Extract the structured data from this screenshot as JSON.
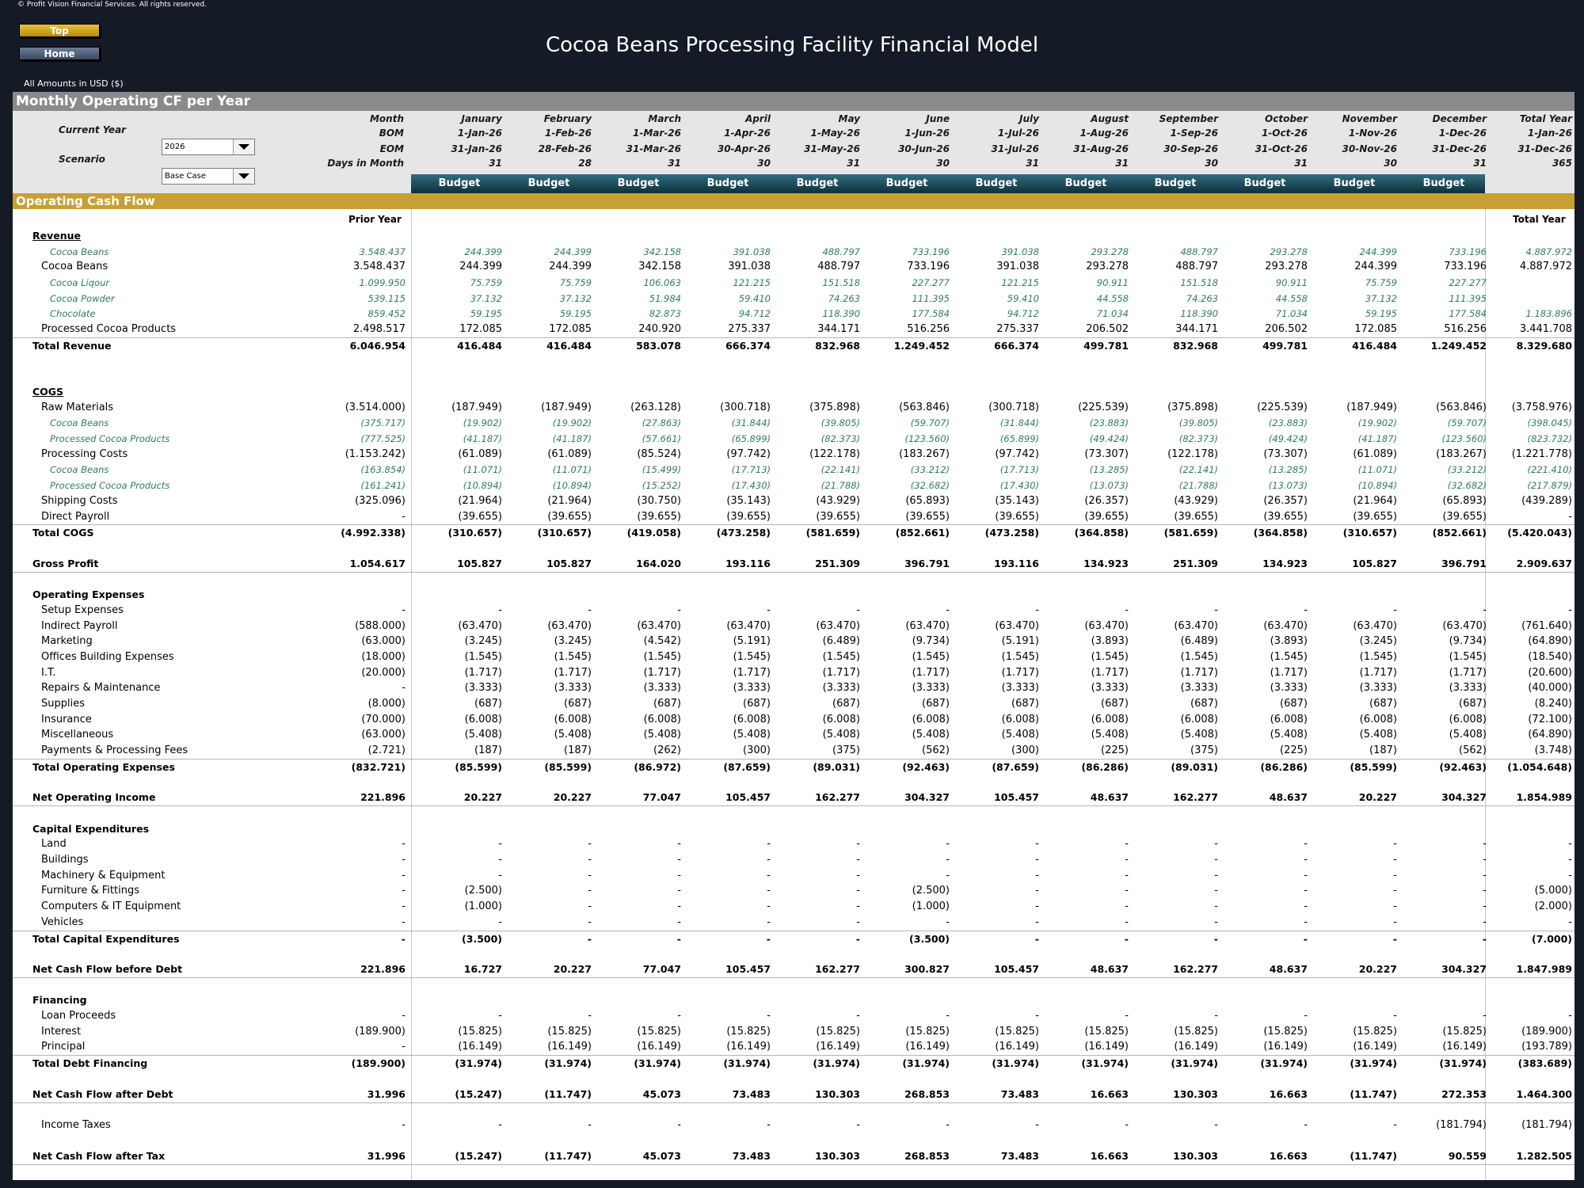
{
  "copyright": "© Profit Vision Financial Services. All rights reserved.",
  "nav": {
    "top": "Top",
    "home": "Home"
  },
  "title": "Cocoa Beans Processing Facility Financial Model",
  "amounts_label": "All Amounts in  USD ($)",
  "section_title": "Monthly Operating CF per Year",
  "current_year": {
    "label": "Current Year",
    "value": "2026"
  },
  "scenario": {
    "label": "Scenario",
    "value": "Base Case"
  },
  "header_labels": [
    "Month",
    "BOM",
    "EOM",
    "Days in Month"
  ],
  "months": [
    {
      "name": "January",
      "bom": "1-Jan-26",
      "eom": "31-Jan-26",
      "days": "31",
      "budget": "Budget"
    },
    {
      "name": "February",
      "bom": "1-Feb-26",
      "eom": "28-Feb-26",
      "days": "28",
      "budget": "Budget"
    },
    {
      "name": "March",
      "bom": "1-Mar-26",
      "eom": "31-Mar-26",
      "days": "31",
      "budget": "Budget"
    },
    {
      "name": "April",
      "bom": "1-Apr-26",
      "eom": "30-Apr-26",
      "days": "30",
      "budget": "Budget"
    },
    {
      "name": "May",
      "bom": "1-May-26",
      "eom": "31-May-26",
      "days": "31",
      "budget": "Budget"
    },
    {
      "name": "June",
      "bom": "1-Jun-26",
      "eom": "30-Jun-26",
      "days": "30",
      "budget": "Budget"
    },
    {
      "name": "July",
      "bom": "1-Jul-26",
      "eom": "31-Jul-26",
      "days": "31",
      "budget": "Budget"
    },
    {
      "name": "August",
      "bom": "1-Aug-26",
      "eom": "31-Aug-26",
      "days": "31",
      "budget": "Budget"
    },
    {
      "name": "September",
      "bom": "1-Sep-26",
      "eom": "30-Sep-26",
      "days": "30",
      "budget": "Budget"
    },
    {
      "name": "October",
      "bom": "1-Oct-26",
      "eom": "31-Oct-26",
      "days": "31",
      "budget": "Budget"
    },
    {
      "name": "November",
      "bom": "1-Nov-26",
      "eom": "30-Nov-26",
      "days": "30",
      "budget": "Budget"
    },
    {
      "name": "December",
      "bom": "1-Dec-26",
      "eom": "31-Dec-26",
      "days": "31",
      "budget": "Budget"
    }
  ],
  "total_col": {
    "name": "Total Year",
    "bom": "1-Jan-26",
    "eom": "31-Dec-26",
    "days": "365"
  },
  "ocf_title": "Operating Cash Flow",
  "prior_year_label": "Prior Year",
  "total_year_label": "Total Year",
  "rows": [
    {
      "label": "Revenue",
      "style": "head u",
      "indent": 0
    },
    {
      "label": "Cocoa Beans",
      "style": "sub",
      "indent": 2,
      "prior": "3.548.437",
      "v": [
        "244.399",
        "244.399",
        "342.158",
        "391.038",
        "488.797",
        "733.196",
        "391.038",
        "293.278",
        "488.797",
        "293.278",
        "244.399",
        "733.196"
      ],
      "total": "4.887.972"
    },
    {
      "label": "Cocoa Beans",
      "style": "",
      "indent": 1,
      "prior": "3.548.437",
      "v": [
        "244.399",
        "244.399",
        "342.158",
        "391.038",
        "488.797",
        "733.196",
        "391.038",
        "293.278",
        "488.797",
        "293.278",
        "244.399",
        "733.196"
      ],
      "total": "4.887.972"
    },
    {
      "label": "Cocoa Liqour",
      "style": "sub",
      "indent": 2,
      "prior": "1.099.950",
      "v": [
        "75.759",
        "75.759",
        "106.063",
        "121.215",
        "151.518",
        "227.277",
        "121.215",
        "90.911",
        "151.518",
        "90.911",
        "75.759",
        "227.277"
      ],
      "total": ""
    },
    {
      "label": "Cocoa Powder",
      "style": "sub",
      "indent": 2,
      "prior": "539.115",
      "v": [
        "37.132",
        "37.132",
        "51.984",
        "59.410",
        "74.263",
        "111.395",
        "59.410",
        "44.558",
        "74.263",
        "44.558",
        "37.132",
        "111.395"
      ],
      "total": ""
    },
    {
      "label": "Chocolate",
      "style": "sub",
      "indent": 2,
      "prior": "859.452",
      "v": [
        "59.195",
        "59.195",
        "82.873",
        "94.712",
        "118.390",
        "177.584",
        "94.712",
        "71.034",
        "118.390",
        "71.034",
        "59.195",
        "177.584"
      ],
      "total": "1.183.896"
    },
    {
      "label": "Processed Cocoa Products",
      "style": "",
      "indent": 1,
      "prior": "2.498.517",
      "v": [
        "172.085",
        "172.085",
        "240.920",
        "275.337",
        "344.171",
        "516.256",
        "275.337",
        "206.502",
        "344.171",
        "206.502",
        "172.085",
        "516.256"
      ],
      "total": "3.441.708"
    },
    {
      "label": "Total Revenue",
      "style": "bold top",
      "indent": 0,
      "prior": "6.046.954",
      "v": [
        "416.484",
        "416.484",
        "583.078",
        "666.374",
        "832.968",
        "1.249.452",
        "666.374",
        "499.781",
        "832.968",
        "499.781",
        "416.484",
        "1.249.452"
      ],
      "total": "8.329.680"
    },
    {
      "label": "COGS",
      "style": "head u",
      "indent": 0,
      "gap": 2
    },
    {
      "label": "Raw Materials",
      "style": "",
      "indent": 1,
      "prior": "(3.514.000)",
      "v": [
        "(187.949)",
        "(187.949)",
        "(263.128)",
        "(300.718)",
        "(375.898)",
        "(563.846)",
        "(300.718)",
        "(225.539)",
        "(375.898)",
        "(225.539)",
        "(187.949)",
        "(563.846)"
      ],
      "total": "(3.758.976)"
    },
    {
      "label": "Cocoa Beans",
      "style": "sub",
      "indent": 2,
      "prior": "(375.717)",
      "v": [
        "(19.902)",
        "(19.902)",
        "(27.863)",
        "(31.844)",
        "(39.805)",
        "(59.707)",
        "(31.844)",
        "(23.883)",
        "(39.805)",
        "(23.883)",
        "(19.902)",
        "(59.707)"
      ],
      "total": "(398.045)"
    },
    {
      "label": "Processed Cocoa Products",
      "style": "sub",
      "indent": 2,
      "prior": "(777.525)",
      "v": [
        "(41.187)",
        "(41.187)",
        "(57.661)",
        "(65.899)",
        "(82.373)",
        "(123.560)",
        "(65.899)",
        "(49.424)",
        "(82.373)",
        "(49.424)",
        "(41.187)",
        "(123.560)"
      ],
      "total": "(823.732)"
    },
    {
      "label": "Processing Costs",
      "style": "",
      "indent": 1,
      "prior": "(1.153.242)",
      "v": [
        "(61.089)",
        "(61.089)",
        "(85.524)",
        "(97.742)",
        "(122.178)",
        "(183.267)",
        "(97.742)",
        "(73.307)",
        "(122.178)",
        "(73.307)",
        "(61.089)",
        "(183.267)"
      ],
      "total": "(1.221.778)"
    },
    {
      "label": "Cocoa Beans",
      "style": "sub",
      "indent": 2,
      "prior": "(163.854)",
      "v": [
        "(11.071)",
        "(11.071)",
        "(15.499)",
        "(17.713)",
        "(22.141)",
        "(33.212)",
        "(17.713)",
        "(13.285)",
        "(22.141)",
        "(13.285)",
        "(11.071)",
        "(33.212)"
      ],
      "total": "(221.410)"
    },
    {
      "label": "Processed Cocoa Products",
      "style": "sub",
      "indent": 2,
      "prior": "(161.241)",
      "v": [
        "(10.894)",
        "(10.894)",
        "(15.252)",
        "(17.430)",
        "(21.788)",
        "(32.682)",
        "(17.430)",
        "(13.073)",
        "(21.788)",
        "(13.073)",
        "(10.894)",
        "(32.682)"
      ],
      "total": "(217.879)"
    },
    {
      "label": "Shipping Costs",
      "style": "",
      "indent": 1,
      "prior": "(325.096)",
      "v": [
        "(21.964)",
        "(21.964)",
        "(30.750)",
        "(35.143)",
        "(43.929)",
        "(65.893)",
        "(35.143)",
        "(26.357)",
        "(43.929)",
        "(26.357)",
        "(21.964)",
        "(65.893)"
      ],
      "total": "(439.289)"
    },
    {
      "label": "Direct Payroll",
      "style": "",
      "indent": 1,
      "prior": "-",
      "v": [
        "(39.655)",
        "(39.655)",
        "(39.655)",
        "(39.655)",
        "(39.655)",
        "(39.655)",
        "(39.655)",
        "(39.655)",
        "(39.655)",
        "(39.655)",
        "(39.655)",
        "(39.655)"
      ],
      "total": "-"
    },
    {
      "label": "Total COGS",
      "style": "bold top",
      "indent": 0,
      "prior": "(4.992.338)",
      "v": [
        "(310.657)",
        "(310.657)",
        "(419.058)",
        "(473.258)",
        "(581.659)",
        "(852.661)",
        "(473.258)",
        "(364.858)",
        "(581.659)",
        "(364.858)",
        "(310.657)",
        "(852.661)"
      ],
      "total": "(5.420.043)"
    },
    {
      "label": "Gross Profit",
      "style": "bold btm",
      "indent": 0,
      "gap": 1,
      "prior": "1.054.617",
      "v": [
        "105.827",
        "105.827",
        "164.020",
        "193.116",
        "251.309",
        "396.791",
        "193.116",
        "134.923",
        "251.309",
        "134.923",
        "105.827",
        "396.791"
      ],
      "total": "2.909.637"
    },
    {
      "label": "Operating Expenses",
      "style": "head",
      "indent": 0,
      "gap": 1
    },
    {
      "label": "Setup Expenses",
      "style": "",
      "indent": 1,
      "prior": "-",
      "v": [
        "-",
        "-",
        "-",
        "-",
        "-",
        "-",
        "-",
        "-",
        "-",
        "-",
        "-",
        "-"
      ],
      "total": "-"
    },
    {
      "label": "Indirect Payroll",
      "style": "",
      "indent": 1,
      "prior": "(588.000)",
      "v": [
        "(63.470)",
        "(63.470)",
        "(63.470)",
        "(63.470)",
        "(63.470)",
        "(63.470)",
        "(63.470)",
        "(63.470)",
        "(63.470)",
        "(63.470)",
        "(63.470)",
        "(63.470)"
      ],
      "total": "(761.640)"
    },
    {
      "label": "Marketing",
      "style": "",
      "indent": 1,
      "prior": "(63.000)",
      "v": [
        "(3.245)",
        "(3.245)",
        "(4.542)",
        "(5.191)",
        "(6.489)",
        "(9.734)",
        "(5.191)",
        "(3.893)",
        "(6.489)",
        "(3.893)",
        "(3.245)",
        "(9.734)"
      ],
      "total": "(64.890)"
    },
    {
      "label": "Offices Building Expenses",
      "style": "",
      "indent": 1,
      "prior": "(18.000)",
      "v": [
        "(1.545)",
        "(1.545)",
        "(1.545)",
        "(1.545)",
        "(1.545)",
        "(1.545)",
        "(1.545)",
        "(1.545)",
        "(1.545)",
        "(1.545)",
        "(1.545)",
        "(1.545)"
      ],
      "total": "(18.540)"
    },
    {
      "label": "I.T.",
      "style": "",
      "indent": 1,
      "prior": "(20.000)",
      "v": [
        "(1.717)",
        "(1.717)",
        "(1.717)",
        "(1.717)",
        "(1.717)",
        "(1.717)",
        "(1.717)",
        "(1.717)",
        "(1.717)",
        "(1.717)",
        "(1.717)",
        "(1.717)"
      ],
      "total": "(20.600)"
    },
    {
      "label": "Repairs & Maintenance",
      "style": "",
      "indent": 1,
      "prior": "-",
      "v": [
        "(3.333)",
        "(3.333)",
        "(3.333)",
        "(3.333)",
        "(3.333)",
        "(3.333)",
        "(3.333)",
        "(3.333)",
        "(3.333)",
        "(3.333)",
        "(3.333)",
        "(3.333)"
      ],
      "total": "(40.000)"
    },
    {
      "label": "Supplies",
      "style": "",
      "indent": 1,
      "prior": "(8.000)",
      "v": [
        "(687)",
        "(687)",
        "(687)",
        "(687)",
        "(687)",
        "(687)",
        "(687)",
        "(687)",
        "(687)",
        "(687)",
        "(687)",
        "(687)"
      ],
      "total": "(8.240)"
    },
    {
      "label": "Insurance",
      "style": "",
      "indent": 1,
      "prior": "(70.000)",
      "v": [
        "(6.008)",
        "(6.008)",
        "(6.008)",
        "(6.008)",
        "(6.008)",
        "(6.008)",
        "(6.008)",
        "(6.008)",
        "(6.008)",
        "(6.008)",
        "(6.008)",
        "(6.008)"
      ],
      "total": "(72.100)"
    },
    {
      "label": "Miscellaneous",
      "style": "",
      "indent": 1,
      "prior": "(63.000)",
      "v": [
        "(5.408)",
        "(5.408)",
        "(5.408)",
        "(5.408)",
        "(5.408)",
        "(5.408)",
        "(5.408)",
        "(5.408)",
        "(5.408)",
        "(5.408)",
        "(5.408)",
        "(5.408)"
      ],
      "total": "(64.890)"
    },
    {
      "label": "Payments & Processing Fees",
      "style": "",
      "indent": 1,
      "prior": "(2.721)",
      "v": [
        "(187)",
        "(187)",
        "(262)",
        "(300)",
        "(375)",
        "(562)",
        "(300)",
        "(225)",
        "(375)",
        "(225)",
        "(187)",
        "(562)"
      ],
      "total": "(3.748)"
    },
    {
      "label": "Total Operating Expenses",
      "style": "bold top",
      "indent": 0,
      "prior": "(832.721)",
      "v": [
        "(85.599)",
        "(85.599)",
        "(86.972)",
        "(87.659)",
        "(89.031)",
        "(92.463)",
        "(87.659)",
        "(86.286)",
        "(89.031)",
        "(86.286)",
        "(85.599)",
        "(92.463)"
      ],
      "total": "(1.054.648)"
    },
    {
      "label": "Net Operating Income",
      "style": "bold btm",
      "indent": 0,
      "gap": 1,
      "prior": "221.896",
      "v": [
        "20.227",
        "20.227",
        "77.047",
        "105.457",
        "162.277",
        "304.327",
        "105.457",
        "48.637",
        "162.277",
        "48.637",
        "20.227",
        "304.327"
      ],
      "total": "1.854.989"
    },
    {
      "label": "Capital Expenditures",
      "style": "head",
      "indent": 0,
      "gap": 1
    },
    {
      "label": "Land",
      "style": "",
      "indent": 1,
      "prior": "-",
      "v": [
        "-",
        "-",
        "-",
        "-",
        "-",
        "-",
        "-",
        "-",
        "-",
        "-",
        "-",
        "-"
      ],
      "total": "-"
    },
    {
      "label": "Buildings",
      "style": "",
      "indent": 1,
      "prior": "-",
      "v": [
        "-",
        "-",
        "-",
        "-",
        "-",
        "-",
        "-",
        "-",
        "-",
        "-",
        "-",
        "-"
      ],
      "total": "-"
    },
    {
      "label": "Machinery & Equipment",
      "style": "",
      "indent": 1,
      "prior": "-",
      "v": [
        "-",
        "-",
        "-",
        "-",
        "-",
        "-",
        "-",
        "-",
        "-",
        "-",
        "-",
        "-"
      ],
      "total": "-"
    },
    {
      "label": "Furniture & Fittings",
      "style": "",
      "indent": 1,
      "prior": "-",
      "v": [
        "(2.500)",
        "-",
        "-",
        "-",
        "-",
        "(2.500)",
        "-",
        "-",
        "-",
        "-",
        "-",
        "-"
      ],
      "total": "(5.000)"
    },
    {
      "label": "Computers & IT Equipment",
      "style": "",
      "indent": 1,
      "prior": "-",
      "v": [
        "(1.000)",
        "-",
        "-",
        "-",
        "-",
        "(1.000)",
        "-",
        "-",
        "-",
        "-",
        "-",
        "-"
      ],
      "total": "(2.000)"
    },
    {
      "label": "Vehicles",
      "style": "",
      "indent": 1,
      "prior": "-",
      "v": [
        "-",
        "-",
        "-",
        "-",
        "-",
        "-",
        "-",
        "-",
        "-",
        "-",
        "-",
        "-"
      ],
      "total": "-"
    },
    {
      "label": "Total Capital Expenditures",
      "style": "bold top",
      "indent": 0,
      "prior": "-",
      "v": [
        "(3.500)",
        "-",
        "-",
        "-",
        "-",
        "(3.500)",
        "-",
        "-",
        "-",
        "-",
        "-",
        "-"
      ],
      "total": "(7.000)"
    },
    {
      "label": "Net Cash Flow before Debt",
      "style": "bold btm",
      "indent": 0,
      "gap": 1,
      "prior": "221.896",
      "v": [
        "16.727",
        "20.227",
        "77.047",
        "105.457",
        "162.277",
        "300.827",
        "105.457",
        "48.637",
        "162.277",
        "48.637",
        "20.227",
        "304.327"
      ],
      "total": "1.847.989"
    },
    {
      "label": "Financing",
      "style": "head",
      "indent": 0,
      "gap": 1
    },
    {
      "label": "Loan Proceeds",
      "style": "",
      "indent": 1,
      "prior": "-",
      "v": [
        "-",
        "-",
        "-",
        "-",
        "-",
        "-",
        "-",
        "-",
        "-",
        "-",
        "-",
        "-"
      ],
      "total": "-"
    },
    {
      "label": "Interest",
      "style": "",
      "indent": 1,
      "prior": "(189.900)",
      "v": [
        "(15.825)",
        "(15.825)",
        "(15.825)",
        "(15.825)",
        "(15.825)",
        "(15.825)",
        "(15.825)",
        "(15.825)",
        "(15.825)",
        "(15.825)",
        "(15.825)",
        "(15.825)"
      ],
      "total": "(189.900)"
    },
    {
      "label": "Principal",
      "style": "",
      "indent": 1,
      "prior": "-",
      "v": [
        "(16.149)",
        "(16.149)",
        "(16.149)",
        "(16.149)",
        "(16.149)",
        "(16.149)",
        "(16.149)",
        "(16.149)",
        "(16.149)",
        "(16.149)",
        "(16.149)",
        "(16.149)"
      ],
      "total": "(193.789)"
    },
    {
      "label": "Total Debt Financing",
      "style": "bold top",
      "indent": 0,
      "prior": "(189.900)",
      "v": [
        "(31.974)",
        "(31.974)",
        "(31.974)",
        "(31.974)",
        "(31.974)",
        "(31.974)",
        "(31.974)",
        "(31.974)",
        "(31.974)",
        "(31.974)",
        "(31.974)",
        "(31.974)"
      ],
      "total": "(383.689)"
    },
    {
      "label": "Net Cash Flow after Debt",
      "style": "bold btm",
      "indent": 0,
      "gap": 1,
      "prior": "31.996",
      "v": [
        "(15.247)",
        "(11.747)",
        "45.073",
        "73.483",
        "130.303",
        "268.853",
        "73.483",
        "16.663",
        "130.303",
        "16.663",
        "(11.747)",
        "272.353"
      ],
      "total": "1.464.300"
    },
    {
      "label": "Income Taxes",
      "style": "",
      "indent": 1,
      "gap": 1,
      "prior": "-",
      "v": [
        "-",
        "-",
        "-",
        "-",
        "-",
        "-",
        "-",
        "-",
        "-",
        "-",
        "-",
        "(181.794)"
      ],
      "total": "(181.794)"
    },
    {
      "label": "Net Cash Flow after Tax",
      "style": "bold btm",
      "indent": 0,
      "gap": 1,
      "prior": "31.996",
      "v": [
        "(15.247)",
        "(11.747)",
        "45.073",
        "73.483",
        "130.303",
        "268.853",
        "73.483",
        "16.663",
        "130.303",
        "16.663",
        "(11.747)",
        "90.559"
      ],
      "total": "1.282.505"
    }
  ]
}
